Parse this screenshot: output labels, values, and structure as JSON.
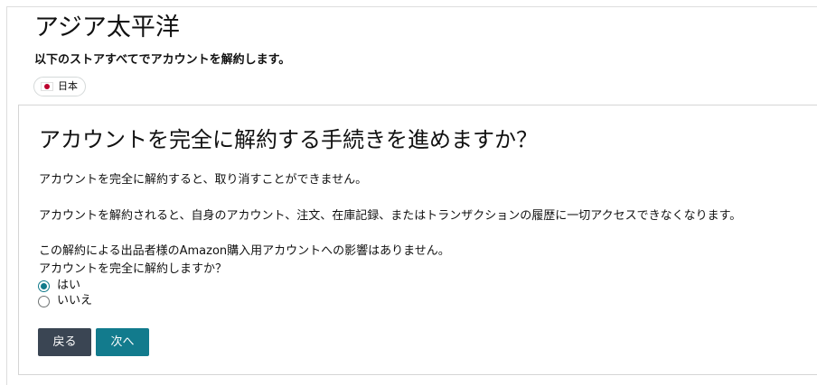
{
  "header": {
    "region_title": "アジア太平洋",
    "subtitle": "以下のストアすべてでアカウントを解約します。",
    "countries": [
      {
        "label": "日本",
        "flag": "japan-flag-icon"
      }
    ]
  },
  "dialog": {
    "title": "アカウントを完全に解約する手続きを進めますか？",
    "paragraph_1": "アカウントを完全に解約すると、取り消すことができません。",
    "paragraph_2": "アカウントを解約されると、自身のアカウント、注文、在庫記録、またはトランザクションの履歴に一切アクセスできなくなります。",
    "paragraph_3": "この解約による出品者様のAmazon購入用アカウントへの影響はありません。",
    "question": "アカウントを完全に解約しますか？",
    "options": [
      {
        "label": "はい",
        "selected": true
      },
      {
        "label": "いいえ",
        "selected": false
      }
    ],
    "back_label": "戻る",
    "next_label": "次へ"
  },
  "colors": {
    "accent": "#127b8d",
    "back_button": "#3a4553",
    "border": "#d5d5d5"
  }
}
